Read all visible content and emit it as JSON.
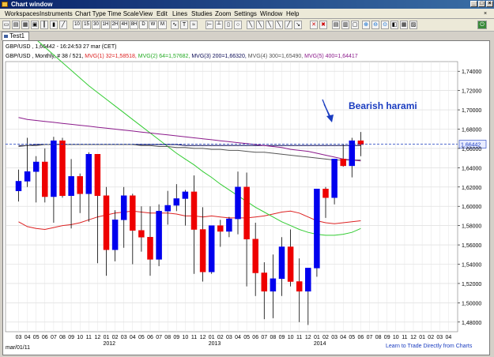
{
  "window": {
    "title": "Chart window"
  },
  "menu": [
    "Workspaces",
    "Instruments",
    "Chart Type",
    "Time Scale",
    "View",
    "Edit",
    "Lines",
    "Studies",
    "Zoom",
    "Settings",
    "Window",
    "Help"
  ],
  "toolbar": {
    "timeframes": [
      "10",
      "15",
      "30",
      "1H",
      "2H",
      "4H",
      "8H",
      "D",
      "W",
      "M"
    ]
  },
  "tabs": [
    {
      "label": "Test1"
    }
  ],
  "chart_header": {
    "instrument": "GBP/USD , 1,66442 - 16:24:53  27 mar (CET)",
    "settings": "GBP/USD , Monthly, # 38 / 521,",
    "mvg1": "MVG(1) 32=1,58518,",
    "mvg2": "MVG(2) 64=1,57682,",
    "mvg3": "MVG(3) 200=1,66320,",
    "mvg4": "MVG(4) 300=1,65490,",
    "mvg5": "MVG(5) 400=1,64417"
  },
  "annotation": {
    "text": "Bearish harami"
  },
  "price_tag": "1,66442",
  "footer": {
    "date_label": "mar/01/11",
    "link": "Learn to Trade Directly from Charts"
  },
  "colors": {
    "bull": "#0000ee",
    "bear": "#ee0000",
    "mvg1": "#dd2222",
    "mvg2": "#33cc33",
    "mvg3": "#0a0a55",
    "mvg4": "#555555",
    "mvg5": "#8b1a8b",
    "annotation": "#1a3cc0",
    "title_bar": "#0a246a"
  },
  "chart_data": {
    "type": "candlestick",
    "instrument": "GBP/USD",
    "timeframe": "Monthly",
    "y_range": [
      1.47,
      1.75
    ],
    "y_ticks": [
      "1,74000",
      "1,72000",
      "1,70000",
      "1,68000",
      "1,66000",
      "1,64000",
      "1,62000",
      "1,60000",
      "1,58000",
      "1,56000",
      "1,54000",
      "1,52000",
      "1,50000",
      "1,48000"
    ],
    "x_labels": [
      "03",
      "04",
      "05",
      "06",
      "07",
      "08",
      "09",
      "10",
      "11",
      "12",
      "01",
      "02",
      "03",
      "04",
      "05",
      "06",
      "07",
      "08",
      "09",
      "10",
      "11",
      "12",
      "01",
      "02",
      "03",
      "04",
      "05",
      "06",
      "07",
      "08",
      "09",
      "10",
      "11",
      "12",
      "01",
      "02",
      "03",
      "04",
      "05",
      "06",
      "07",
      "08",
      "09",
      "10",
      "11",
      "12",
      "01",
      "02",
      "03",
      "04"
    ],
    "year_labels": [
      {
        "label": "2012",
        "index": 10
      },
      {
        "label": "2013",
        "index": 22
      },
      {
        "label": "2014",
        "index": 34
      }
    ],
    "last_price": 1.66442,
    "candles": [
      {
        "o": 1.616,
        "h": 1.638,
        "l": 1.605,
        "c": 1.626
      },
      {
        "o": 1.626,
        "h": 1.671,
        "l": 1.62,
        "c": 1.636
      },
      {
        "o": 1.636,
        "h": 1.652,
        "l": 1.604,
        "c": 1.646
      },
      {
        "o": 1.646,
        "h": 1.66,
        "l": 1.604,
        "c": 1.61
      },
      {
        "o": 1.61,
        "h": 1.672,
        "l": 1.583,
        "c": 1.668
      },
      {
        "o": 1.668,
        "h": 1.671,
        "l": 1.609,
        "c": 1.611
      },
      {
        "o": 1.611,
        "h": 1.649,
        "l": 1.577,
        "c": 1.631
      },
      {
        "o": 1.631,
        "h": 1.634,
        "l": 1.593,
        "c": 1.613
      },
      {
        "o": 1.613,
        "h": 1.656,
        "l": 1.584,
        "c": 1.654
      },
      {
        "o": 1.654,
        "h": 1.619,
        "l": 1.541,
        "c": 1.611
      },
      {
        "o": 1.611,
        "h": 1.62,
        "l": 1.528,
        "c": 1.555
      },
      {
        "o": 1.555,
        "h": 1.596,
        "l": 1.543,
        "c": 1.586
      },
      {
        "o": 1.586,
        "h": 1.62,
        "l": 1.557,
        "c": 1.611
      },
      {
        "o": 1.611,
        "h": 1.613,
        "l": 1.54,
        "c": 1.575
      },
      {
        "o": 1.575,
        "h": 1.6,
        "l": 1.553,
        "c": 1.568
      },
      {
        "o": 1.568,
        "h": 1.6,
        "l": 1.528,
        "c": 1.545
      },
      {
        "o": 1.545,
        "h": 1.602,
        "l": 1.538,
        "c": 1.595
      },
      {
        "o": 1.595,
        "h": 1.616,
        "l": 1.581,
        "c": 1.601
      },
      {
        "o": 1.601,
        "h": 1.623,
        "l": 1.595,
        "c": 1.608
      },
      {
        "o": 1.608,
        "h": 1.617,
        "l": 1.58,
        "c": 1.615
      },
      {
        "o": 1.615,
        "h": 1.632,
        "l": 1.53,
        "c": 1.576
      },
      {
        "o": 1.576,
        "h": 1.599,
        "l": 1.522,
        "c": 1.532
      },
      {
        "o": 1.532,
        "h": 1.576,
        "l": 1.53,
        "c": 1.58
      },
      {
        "o": 1.58,
        "h": 1.586,
        "l": 1.558,
        "c": 1.574
      },
      {
        "o": 1.574,
        "h": 1.589,
        "l": 1.568,
        "c": 1.587
      },
      {
        "o": 1.587,
        "h": 1.636,
        "l": 1.571,
        "c": 1.62
      },
      {
        "o": 1.62,
        "h": 1.635,
        "l": 1.517,
        "c": 1.566
      },
      {
        "o": 1.566,
        "h": 1.583,
        "l": 1.507,
        "c": 1.531
      },
      {
        "o": 1.531,
        "h": 1.542,
        "l": 1.483,
        "c": 1.512
      },
      {
        "o": 1.512,
        "h": 1.55,
        "l": 1.484,
        "c": 1.525
      },
      {
        "o": 1.525,
        "h": 1.568,
        "l": 1.507,
        "c": 1.558
      },
      {
        "o": 1.558,
        "h": 1.576,
        "l": 1.517,
        "c": 1.522
      },
      {
        "o": 1.522,
        "h": 1.546,
        "l": 1.48,
        "c": 1.512
      },
      {
        "o": 1.512,
        "h": 1.518,
        "l": 1.477,
        "c": 1.536
      },
      {
        "o": 1.536,
        "h": 1.612,
        "l": 1.527,
        "c": 1.618
      },
      {
        "o": 1.618,
        "h": 1.62,
        "l": 1.588,
        "c": 1.609
      },
      {
        "o": 1.609,
        "h": 1.647,
        "l": 1.602,
        "c": 1.649
      },
      {
        "o": 1.649,
        "h": 1.664,
        "l": 1.641,
        "c": 1.642
      },
      {
        "o": 1.642,
        "h": 1.671,
        "l": 1.63,
        "c": 1.668
      },
      {
        "o": 1.668,
        "h": 1.677,
        "l": 1.652,
        "c": 1.664
      }
    ],
    "series": [
      {
        "name": "MVG(1) 32",
        "values": [
          1.584,
          1.579,
          1.577,
          1.576,
          1.578,
          1.58,
          1.581,
          1.583,
          1.586,
          1.589,
          1.591,
          1.593,
          1.594,
          1.595,
          1.594,
          1.593,
          1.593,
          1.593,
          1.592,
          1.59,
          1.59,
          1.589,
          1.59,
          1.589,
          1.588,
          1.588,
          1.588,
          1.589,
          1.59,
          1.592,
          1.594,
          1.595,
          1.593,
          1.589,
          1.585,
          1.583,
          1.582,
          1.583,
          1.584,
          1.585
        ]
      },
      {
        "name": "MVG(2) 64",
        "values": [
          1.789,
          1.781,
          1.773,
          1.765,
          1.757,
          1.749,
          1.741,
          1.733,
          1.725,
          1.718,
          1.711,
          1.704,
          1.697,
          1.69,
          1.683,
          1.676,
          1.669,
          1.662,
          1.655,
          1.649,
          1.643,
          1.636,
          1.63,
          1.623,
          1.617,
          1.611,
          1.605,
          1.599,
          1.594,
          1.589,
          1.584,
          1.58,
          1.576,
          1.573,
          1.571,
          1.57,
          1.57,
          1.571,
          1.573,
          1.577
        ]
      },
      {
        "name": "MVG(3) 200",
        "values": [
          1.663,
          1.663,
          1.664,
          1.664,
          1.664,
          1.664,
          1.664,
          1.664,
          1.664,
          1.664,
          1.664,
          1.664,
          1.664,
          1.664,
          1.664,
          1.664,
          1.664,
          1.664,
          1.664,
          1.663,
          1.663,
          1.663,
          1.663,
          1.663,
          1.663,
          1.663,
          1.663,
          1.663,
          1.663,
          1.663,
          1.663,
          1.663,
          1.663,
          1.663,
          1.663,
          1.663,
          1.663,
          1.663,
          1.663,
          1.663
        ]
      },
      {
        "name": "MVG(4) 300",
        "values": [
          1.662,
          1.663,
          1.663,
          1.664,
          1.664,
          1.664,
          1.664,
          1.664,
          1.664,
          1.664,
          1.664,
          1.664,
          1.664,
          1.664,
          1.663,
          1.663,
          1.662,
          1.662,
          1.661,
          1.661,
          1.66,
          1.66,
          1.659,
          1.659,
          1.658,
          1.658,
          1.657,
          1.656,
          1.656,
          1.655,
          1.654,
          1.653,
          1.652,
          1.651,
          1.65,
          1.649,
          1.648,
          1.648,
          1.648,
          1.648
        ]
      },
      {
        "name": "MVG(5) 400",
        "values": [
          1.692,
          1.69,
          1.689,
          1.688,
          1.687,
          1.686,
          1.685,
          1.684,
          1.683,
          1.682,
          1.681,
          1.68,
          1.679,
          1.678,
          1.677,
          1.676,
          1.675,
          1.674,
          1.673,
          1.672,
          1.671,
          1.67,
          1.669,
          1.668,
          1.667,
          1.666,
          1.665,
          1.664,
          1.663,
          1.662,
          1.661,
          1.659,
          1.658,
          1.657,
          1.655,
          1.653,
          1.651,
          1.649,
          1.648,
          1.647
        ]
      }
    ]
  }
}
